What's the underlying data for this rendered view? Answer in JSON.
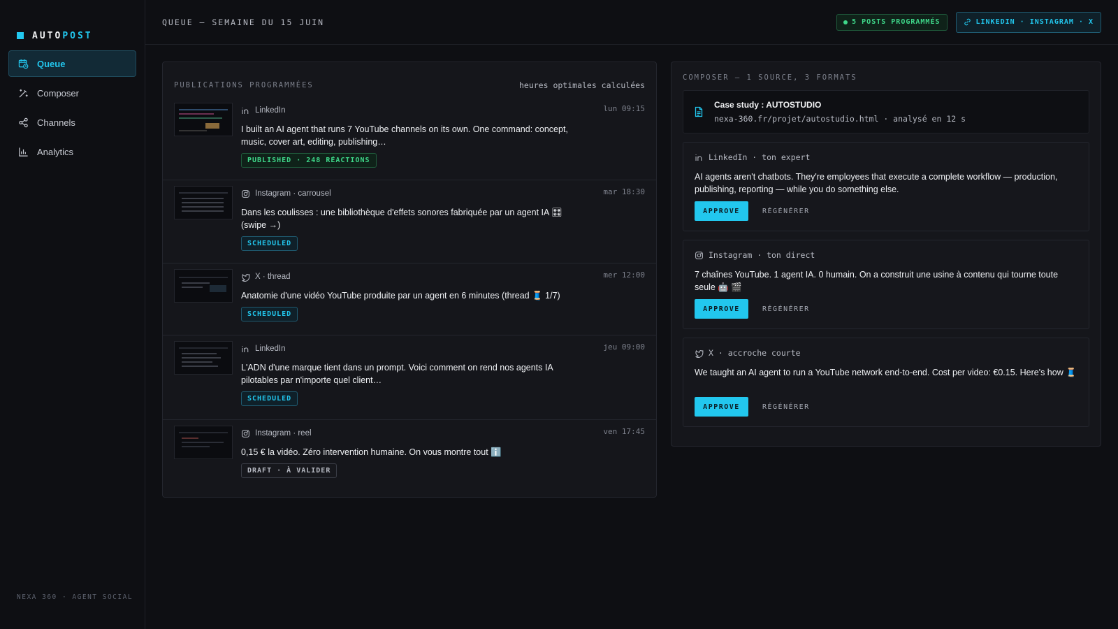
{
  "app": {
    "logo_a": "AUTO",
    "logo_b": "POST",
    "footer": "NEXA 360 · AGENT SOCIAL",
    "accent": "#22c7ee"
  },
  "sidebar": {
    "items": [
      {
        "label": "Queue",
        "icon": "calendar-clock-icon",
        "active": true
      },
      {
        "label": "Composer",
        "icon": "magic-wand-icon"
      },
      {
        "label": "Channels",
        "icon": "share-icon"
      },
      {
        "label": "Analytics",
        "icon": "bar-chart-icon"
      }
    ]
  },
  "topbar": {
    "title": "QUEUE — SEMAINE DU 15 JUIN",
    "scheduled_badge": "5 POSTS PROGRAMMÉS",
    "channels_badge": "LINKEDIN · INSTAGRAM · X"
  },
  "queue": {
    "label": "PUBLICATIONS PROGRAMMÉES",
    "aside": "heures optimales calculées",
    "items": [
      {
        "channel": "LinkedIn",
        "channel_icon": "linkedin-icon",
        "time": "lun 09:15",
        "text": "I built an AI agent that runs 7 YouTube channels on its own. One command: concept, music, cover art, editing, publishing…",
        "status": "PUBLISHED · 248 RÉACTIONS",
        "status_type": "published"
      },
      {
        "channel": "Instagram · carrousel",
        "channel_icon": "instagram-icon",
        "time": "mar 18:30",
        "text": "Dans les coulisses : une bibliothèque d'effets sonores fabriquée par un agent IA 🎛 (swipe →)",
        "status": "SCHEDULED",
        "status_type": "scheduled"
      },
      {
        "channel": "X · thread",
        "channel_icon": "x-bird-icon",
        "time": "mer 12:00",
        "text": "Anatomie d'une vidéo YouTube produite par un agent en 6 minutes (thread 🧵 1/7)",
        "status": "SCHEDULED",
        "status_type": "scheduled"
      },
      {
        "channel": "LinkedIn",
        "channel_icon": "linkedin-icon",
        "time": "jeu 09:00",
        "text": "L'ADN d'une marque tient dans un prompt. Voici comment on rend nos agents IA pilotables par n'importe quel client…",
        "status": "SCHEDULED",
        "status_type": "scheduled"
      },
      {
        "channel": "Instagram · reel",
        "channel_icon": "instagram-icon",
        "time": "ven 17:45",
        "text": "0,15 € la vidéo. Zéro intervention humaine. On vous montre tout ℹ️",
        "status": "DRAFT · À VALIDER",
        "status_type": "draft"
      }
    ]
  },
  "composer": {
    "label": "COMPOSER — 1 SOURCE, 3 FORMATS",
    "source": {
      "title": "Case study : AUTOSTUDIO",
      "meta": "nexa-360.fr/projet/autostudio.html · analysé en 12 s"
    },
    "approve_label": "APPROVE",
    "regen_label": "RÉGÉNÉRER",
    "formats": [
      {
        "channel": "LinkedIn · ton expert",
        "channel_icon": "linkedin-icon",
        "text": "AI agents aren't chatbots. They're employees that execute a complete workflow — production, publishing, reporting — while you do something else."
      },
      {
        "channel": "Instagram · ton direct",
        "channel_icon": "instagram-icon",
        "text": "7 chaînes YouTube. 1 agent IA. 0 humain. On a construit une usine à contenu qui tourne toute seule 🤖 🎬"
      },
      {
        "channel": "X · accroche courte",
        "channel_icon": "x-bird-icon",
        "text": "We taught an AI agent to run a YouTube network end-to-end. Cost per video: €0.15. Here's how 🧵"
      }
    ]
  }
}
